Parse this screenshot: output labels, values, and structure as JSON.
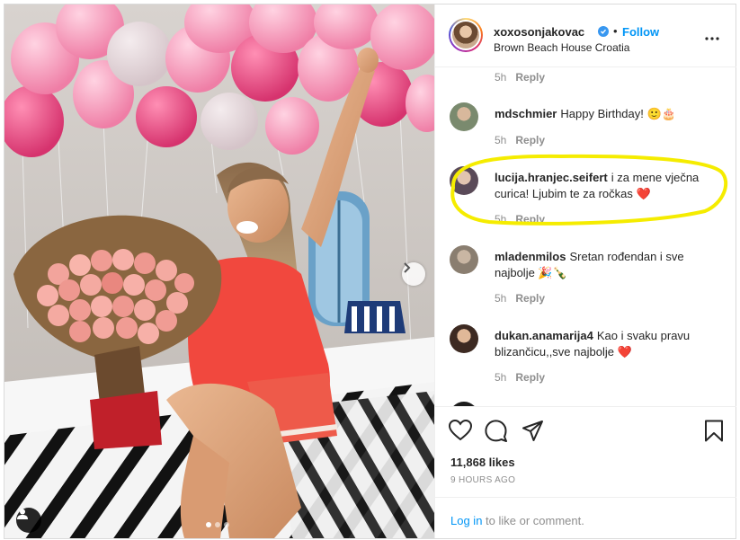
{
  "post": {
    "username": "xoxosonjakovac",
    "follow_label": "Follow",
    "separator": "•",
    "location": "Brown Beach House Croatia",
    "photo_alt": "Woman in red nightwear sitting on bed with pink balloons and bouquet of roses",
    "slide_count": 3,
    "active_slide": 1
  },
  "top_meta": {
    "time": "5h",
    "reply": "Reply"
  },
  "comments": [
    {
      "user": "mdschmier",
      "text": "Happy Birthday! 🙂🎂",
      "time": "5h",
      "reply": "Reply",
      "avatar_color": "#7a8a6e"
    },
    {
      "user": "lucija.hranjec.seifert",
      "text": "i za mene vječna curica! Ljubim te za ročkas ❤️",
      "time": "5h",
      "reply": "Reply",
      "avatar_color": "#5a4a58"
    },
    {
      "user": "mladenmilos",
      "text": "Sretan rođendan i sve najbolje 🎉🍾",
      "time": "5h",
      "reply": "Reply",
      "avatar_color": "#8a7e70"
    },
    {
      "user": "dukan.anamarija4",
      "text": "Kao i svaku pravu blizančicu,,sve najbolje ❤️",
      "time": "5h",
      "reply": "Reply",
      "avatar_color": "#3d2a22"
    }
  ],
  "actions": {
    "likes": "11,868 likes",
    "timestamp": "9 HOURS AGO"
  },
  "login": {
    "link": "Log in",
    "rest": " to like or comment."
  },
  "colors": {
    "accent": "#0095f6",
    "highlight": "#f5ec00",
    "heart": "#ed4956"
  }
}
